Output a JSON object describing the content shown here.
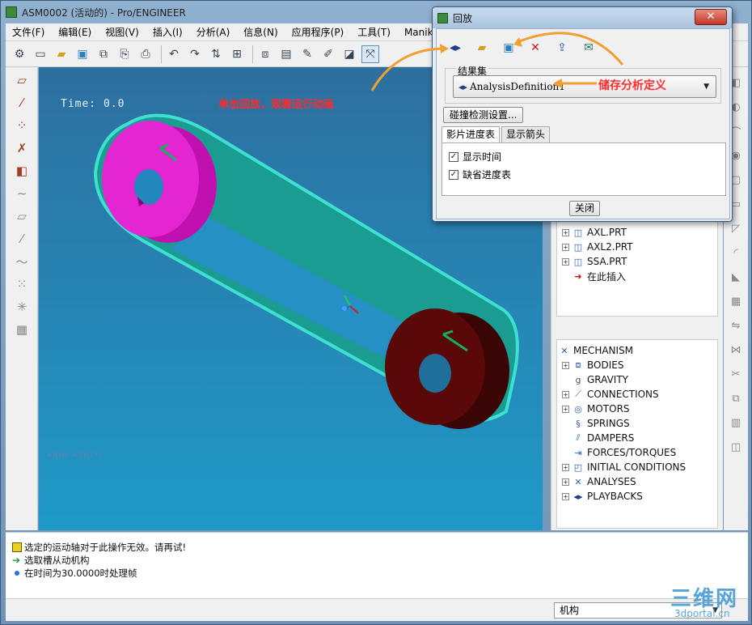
{
  "window": {
    "title": "ASM0002 (活动的) - Pro/ENGINEER"
  },
  "menu": [
    "文件(F)",
    "编辑(E)",
    "视图(V)",
    "插入(I)",
    "分析(A)",
    "信息(N)",
    "应用程序(P)",
    "工具(T)",
    "Manikin(M)"
  ],
  "viewport": {
    "time_label": "Time: 0.0",
    "annotation_click": "单击回放，观看运行动画",
    "faint_label": "ANIM  ASM(*)"
  },
  "model_tree": {
    "items": [
      {
        "label": "AXL.PRT",
        "icon": "part-icon"
      },
      {
        "label": "AXL2.PRT",
        "icon": "part-icon"
      },
      {
        "label": "SSA.PRT",
        "icon": "part-icon"
      },
      {
        "label": "在此插入",
        "icon": "insert-here-arrow-icon"
      }
    ]
  },
  "mechanism_tree": {
    "root": "MECHANISM",
    "items": [
      {
        "label": "BODIES",
        "expandable": true
      },
      {
        "label": "GRAVITY",
        "expandable": false
      },
      {
        "label": "CONNECTIONS",
        "expandable": true
      },
      {
        "label": "MOTORS",
        "expandable": true
      },
      {
        "label": "SPRINGS",
        "expandable": false
      },
      {
        "label": "DAMPERS",
        "expandable": false
      },
      {
        "label": "FORCES/TORQUES",
        "expandable": false
      },
      {
        "label": "INITIAL CONDITIONS",
        "expandable": true
      },
      {
        "label": "ANALYSES",
        "expandable": true
      },
      {
        "label": "PLAYBACKS",
        "expandable": true
      }
    ]
  },
  "messages": [
    {
      "text": "选定的运动轴对于此操作无效。请再试!",
      "icon": "warning-icon"
    },
    {
      "text": "选取槽从动机构",
      "icon": "prompt-arrow-icon"
    },
    {
      "text": "在时间为30.0000时处理帧",
      "icon": "info-dot-icon"
    }
  ],
  "status": {
    "mode": "机构"
  },
  "watermark": {
    "text": "三维网",
    "url": "3dportal.cn"
  },
  "dialog": {
    "title": "回放",
    "result_set_label": "结果集",
    "selected_analysis": "AnalysisDefinition1",
    "collision_button": "碰撞检测设置...",
    "tabs": [
      "影片进度表",
      "显示箭头"
    ],
    "active_tab": 0,
    "checkboxes": [
      {
        "label": "显示时间",
        "checked": true
      },
      {
        "label": "缺省进度表",
        "checked": true
      }
    ],
    "close_button": "关闭",
    "annotation_store": "储存分析定义"
  },
  "colors": {
    "annotation": "#ff2a2a",
    "arrow": "#f0a030",
    "pulley_left": "#e020c8",
    "pulley_right": "#5a0808",
    "belt": "#20b0a0",
    "viewport_top": "#2d6f9f",
    "viewport_bottom": "#1f9ac8"
  }
}
